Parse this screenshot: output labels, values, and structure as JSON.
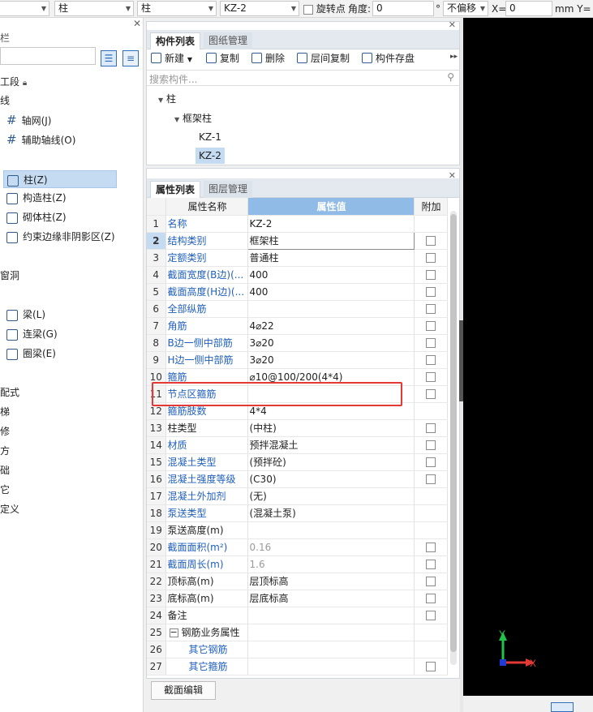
{
  "toolbar": {
    "dd1": "柱",
    "dd2": "柱",
    "dd3": "KZ-2",
    "rotate_label": "旋转点",
    "angle_label": "角度:",
    "angle_value": "0",
    "deg": "°",
    "offset_value": "不偏移",
    "x_label": "X=",
    "x_value": "0",
    "mm_y": "mm Y="
  },
  "left": {
    "header_char": "栏",
    "section1": "工段",
    "line": "线",
    "items_a": [
      "轴网(J)",
      "辅助轴线(O)"
    ],
    "items_b": [
      "柱(Z)",
      "构造柱(Z)",
      "砌体柱(Z)",
      "约束边缘非阴影区(Z)"
    ],
    "section_door": "窗洞",
    "items_c": [
      "梁(L)",
      "连梁(G)",
      "圈梁(E)"
    ],
    "tail": [
      "配式",
      "梯",
      "修",
      "方",
      "础",
      "它",
      "定义"
    ]
  },
  "components": {
    "tabs": [
      "构件列表",
      "图纸管理"
    ],
    "buttons": [
      "新建",
      "复制",
      "删除",
      "层间复制",
      "构件存盘"
    ],
    "search_placeholder": "搜索构件...",
    "tree": {
      "root": "柱",
      "group": "框架柱",
      "items": [
        "KZ-1",
        "KZ-2"
      ]
    }
  },
  "props": {
    "tabs": [
      "属性列表",
      "图层管理"
    ],
    "headers": [
      "属性名称",
      "属性值",
      "附加"
    ],
    "rows": [
      {
        "n": "1",
        "name": "名称",
        "value": "KZ-2",
        "blue": true,
        "check": false
      },
      {
        "n": "2",
        "name": "结构类别",
        "value": "框架柱",
        "blue": true,
        "check": true
      },
      {
        "n": "3",
        "name": "定额类别",
        "value": "普通柱",
        "blue": true,
        "check": true
      },
      {
        "n": "4",
        "name": "截面宽度(B边)(...",
        "value": "400",
        "blue": true,
        "check": true
      },
      {
        "n": "5",
        "name": "截面高度(H边)(...",
        "value": "400",
        "blue": true,
        "check": true
      },
      {
        "n": "6",
        "name": "全部纵筋",
        "value": "",
        "blue": true,
        "check": true
      },
      {
        "n": "7",
        "name": "角筋",
        "value": "4⌀22",
        "blue": true,
        "check": true
      },
      {
        "n": "8",
        "name": "B边一侧中部筋",
        "value": "3⌀20",
        "blue": true,
        "check": true
      },
      {
        "n": "9",
        "name": "H边一侧中部筋",
        "value": "3⌀20",
        "blue": true,
        "check": true
      },
      {
        "n": "10",
        "name": "箍筋",
        "value": "⌀10@100/200(4*4)",
        "blue": true,
        "check": true
      },
      {
        "n": "11",
        "name": "节点区箍筋",
        "value": "",
        "blue": true,
        "check": true
      },
      {
        "n": "12",
        "name": "箍筋肢数",
        "value": "4*4",
        "blue": true,
        "check": false
      },
      {
        "n": "13",
        "name": "柱类型",
        "value": "(中柱)",
        "blue": false,
        "check": true
      },
      {
        "n": "14",
        "name": "材质",
        "value": "预拌混凝土",
        "blue": true,
        "check": true
      },
      {
        "n": "15",
        "name": "混凝土类型",
        "value": "(预拌砼)",
        "blue": true,
        "check": true
      },
      {
        "n": "16",
        "name": "混凝土强度等级",
        "value": "(C30)",
        "blue": true,
        "check": true
      },
      {
        "n": "17",
        "name": "混凝土外加剂",
        "value": "(无)",
        "blue": true,
        "check": false
      },
      {
        "n": "18",
        "name": "泵送类型",
        "value": "(混凝土泵)",
        "blue": true,
        "check": false
      },
      {
        "n": "19",
        "name": "泵送高度(m)",
        "value": "",
        "blue": false,
        "check": false
      },
      {
        "n": "20",
        "name": "截面面积(m²)",
        "value": "0.16",
        "blue": true,
        "gray": true,
        "check": true
      },
      {
        "n": "21",
        "name": "截面周长(m)",
        "value": "1.6",
        "blue": true,
        "gray": true,
        "check": true
      },
      {
        "n": "22",
        "name": "顶标高(m)",
        "value": "层顶标高",
        "blue": false,
        "check": true
      },
      {
        "n": "23",
        "name": "底标高(m)",
        "value": "层底标高",
        "blue": false,
        "check": true
      },
      {
        "n": "24",
        "name": "备注",
        "value": "",
        "blue": false,
        "check": true
      },
      {
        "n": "25",
        "name": "钢筋业务属性",
        "value": "",
        "blue": false,
        "check": false,
        "group": true
      },
      {
        "n": "26",
        "name": "其它钢筋",
        "value": "",
        "blue": true,
        "check": false,
        "indent": true
      },
      {
        "n": "27",
        "name": "其它箍筋",
        "value": "",
        "blue": true,
        "check": true,
        "indent": true
      }
    ],
    "section_button": "截面编辑"
  },
  "canvas": {
    "axis_y": "Y",
    "axis_x": "X"
  },
  "colors": {
    "accent": "#2f5b8f",
    "highlight": "#e53935",
    "selected": "#c5dbf2",
    "link": "#1f5fbf"
  }
}
